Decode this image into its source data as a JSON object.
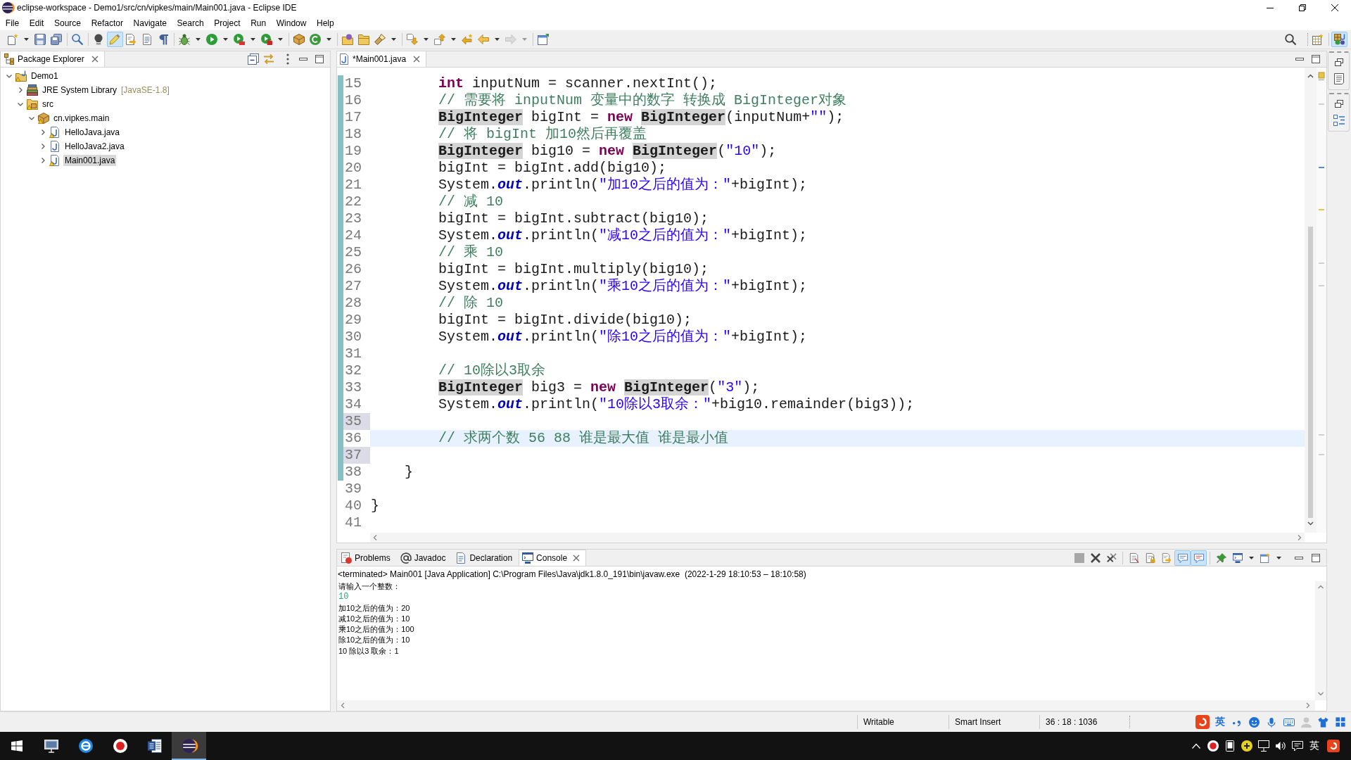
{
  "window": {
    "title": "eclipse-workspace - Demo1/src/cn/vipkes/main/Main001.java - Eclipse IDE"
  },
  "menu": [
    "File",
    "Edit",
    "Source",
    "Refactor",
    "Navigate",
    "Search",
    "Project",
    "Run",
    "Window",
    "Help"
  ],
  "toolbar": {
    "groups": [
      {
        "items": [
          {
            "kind": "new",
            "dropdown": true,
            "on": false,
            "disabled": false
          },
          {
            "kind": "save",
            "dropdown": false,
            "on": false,
            "disabled": false
          },
          {
            "kind": "save_all",
            "dropdown": false,
            "on": false,
            "disabled": false
          }
        ]
      },
      {
        "items": [
          {
            "kind": "open_type",
            "dropdown": false,
            "on": false,
            "disabled": false
          }
        ]
      },
      {
        "items": [
          {
            "kind": "hint",
            "dropdown": false,
            "on": false,
            "disabled": false
          },
          {
            "kind": "mark_occurrences",
            "dropdown": false,
            "on": true,
            "disabled": false
          },
          {
            "kind": "block_selection",
            "dropdown": false,
            "on": false,
            "disabled": false
          },
          {
            "kind": "show_whitespace",
            "dropdown": false,
            "on": false,
            "disabled": false
          },
          {
            "kind": "show_paragraph",
            "dropdown": false,
            "on": false,
            "disabled": false
          }
        ]
      },
      {
        "items": [
          {
            "kind": "debug",
            "dropdown": true,
            "on": false,
            "disabled": false
          },
          {
            "kind": "run",
            "dropdown": true,
            "on": false,
            "disabled": false
          },
          {
            "kind": "coverage",
            "dropdown": true,
            "on": false,
            "disabled": false
          },
          {
            "kind": "external_tools",
            "dropdown": true,
            "on": false,
            "disabled": false
          }
        ]
      },
      {
        "items": [
          {
            "kind": "new_package",
            "dropdown": false,
            "on": false,
            "disabled": false
          },
          {
            "kind": "new_class",
            "dropdown": true,
            "on": false,
            "disabled": false
          }
        ]
      },
      {
        "items": [
          {
            "kind": "open_type_hierarchy",
            "dropdown": false,
            "on": false,
            "disabled": false
          },
          {
            "kind": "open_task",
            "dropdown": false,
            "on": false,
            "disabled": false
          },
          {
            "kind": "search",
            "dropdown": true,
            "on": false,
            "disabled": false
          }
        ]
      },
      {
        "items": [
          {
            "kind": "next_annotation",
            "dropdown": true,
            "on": false,
            "disabled": false
          },
          {
            "kind": "previous_annotation",
            "dropdown": true,
            "on": false,
            "disabled": false
          },
          {
            "kind": "last_edit",
            "dropdown": false,
            "on": false,
            "disabled": false
          },
          {
            "kind": "back",
            "dropdown": true,
            "on": false,
            "disabled": false
          },
          {
            "kind": "forward",
            "dropdown": true,
            "on": false,
            "disabled": true
          }
        ]
      },
      {
        "items": [
          {
            "kind": "pin_editor",
            "dropdown": false,
            "on": false,
            "disabled": false
          }
        ]
      }
    ],
    "right": [
      {
        "kind": "search_all",
        "on": false
      },
      {
        "kind": "open_perspective",
        "on": false
      },
      {
        "kind": "java_perspective",
        "on": true
      }
    ]
  },
  "package_explorer": {
    "tabs": [
      {
        "label": "Package Explorer",
        "selected": true
      }
    ],
    "tree": [
      {
        "label": "Demo1",
        "kind": "project",
        "expanded": true,
        "selected": false,
        "warning": true,
        "children": [
          {
            "label": "JRE System Library",
            "decoration": "[JavaSE-1.8]",
            "kind": "library",
            "expanded": false,
            "selected": false,
            "warning": false
          },
          {
            "label": "src",
            "kind": "source_folder",
            "expanded": true,
            "selected": false,
            "warning": true,
            "children": [
              {
                "label": "cn.vipkes.main",
                "kind": "package",
                "expanded": true,
                "selected": false,
                "warning": true,
                "children": [
                  {
                    "label": "HelloJava.java",
                    "kind": "java_file",
                    "expanded": false,
                    "selected": false,
                    "warning": true
                  },
                  {
                    "label": "HelloJava2.java",
                    "kind": "java_file",
                    "expanded": false,
                    "selected": false,
                    "warning": false
                  },
                  {
                    "label": "Main001.java",
                    "kind": "java_file",
                    "expanded": false,
                    "selected": true,
                    "warning": true
                  }
                ]
              }
            ]
          }
        ]
      }
    ]
  },
  "editor": {
    "tabs": [
      {
        "title": "*Main001.java",
        "selected": true
      }
    ],
    "lines": [
      {
        "number": "15",
        "added": true,
        "changed": false,
        "current": false,
        "tokens": [
          {
            "kind": "keyword",
            "text": "        int"
          },
          {
            "kind": "plain",
            "text": " inputNum = scanner.nextInt();"
          }
        ]
      },
      {
        "number": "16",
        "added": true,
        "changed": false,
        "current": false,
        "tokens": [
          {
            "kind": "comment",
            "text": "        // 需要将 inputNum 变量中的数字 转换成 BigInteger对象"
          }
        ]
      },
      {
        "number": "17",
        "added": true,
        "changed": false,
        "current": false,
        "tokens": [
          {
            "kind": "occurrence",
            "text": "        BigInteger"
          },
          {
            "kind": "plain",
            "text": " bigInt = "
          },
          {
            "kind": "keyword",
            "text": "new "
          },
          {
            "kind": "occurrence",
            "text": "BigInteger"
          },
          {
            "kind": "plain",
            "text": "(inputNum+"
          },
          {
            "kind": "string",
            "text": "\"\""
          },
          {
            "kind": "plain",
            "text": ");"
          }
        ]
      },
      {
        "number": "18",
        "added": true,
        "changed": false,
        "current": false,
        "tokens": [
          {
            "kind": "comment",
            "text": "        // 将 bigInt 加10然后再覆盖"
          }
        ]
      },
      {
        "number": "19",
        "added": true,
        "changed": false,
        "current": false,
        "tokens": [
          {
            "kind": "occurrence",
            "text": "        BigInteger"
          },
          {
            "kind": "plain",
            "text": " big10 = "
          },
          {
            "kind": "keyword",
            "text": "new "
          },
          {
            "kind": "occurrence",
            "text": "BigInteger"
          },
          {
            "kind": "plain",
            "text": "("
          },
          {
            "kind": "string",
            "text": "\"10\""
          },
          {
            "kind": "plain",
            "text": ");"
          }
        ]
      },
      {
        "number": "20",
        "added": true,
        "changed": false,
        "current": false,
        "tokens": [
          {
            "kind": "plain",
            "text": "        bigInt = bigInt.add(big10);"
          }
        ]
      },
      {
        "number": "21",
        "added": true,
        "changed": false,
        "current": false,
        "tokens": [
          {
            "kind": "plain",
            "text": "        System."
          },
          {
            "kind": "field",
            "text": "out"
          },
          {
            "kind": "plain",
            "text": ".println("
          },
          {
            "kind": "string",
            "text": "\"加10之后的值为：\""
          },
          {
            "kind": "plain",
            "text": "+bigInt);"
          }
        ]
      },
      {
        "number": "22",
        "added": true,
        "changed": false,
        "current": false,
        "tokens": [
          {
            "kind": "comment",
            "text": "        // 减 10"
          }
        ]
      },
      {
        "number": "23",
        "added": true,
        "changed": false,
        "current": false,
        "tokens": [
          {
            "kind": "plain",
            "text": "        bigInt = bigInt.subtract(big10);"
          }
        ]
      },
      {
        "number": "24",
        "added": true,
        "changed": false,
        "current": false,
        "tokens": [
          {
            "kind": "plain",
            "text": "        System."
          },
          {
            "kind": "field",
            "text": "out"
          },
          {
            "kind": "plain",
            "text": ".println("
          },
          {
            "kind": "string",
            "text": "\"减10之后的值为：\""
          },
          {
            "kind": "plain",
            "text": "+bigInt);"
          }
        ]
      },
      {
        "number": "25",
        "added": true,
        "changed": false,
        "current": false,
        "tokens": [
          {
            "kind": "comment",
            "text": "        // 乘 10"
          }
        ]
      },
      {
        "number": "26",
        "added": true,
        "changed": false,
        "current": false,
        "tokens": [
          {
            "kind": "plain",
            "text": "        bigInt = bigInt.multiply(big10);"
          }
        ]
      },
      {
        "number": "27",
        "added": true,
        "changed": false,
        "current": false,
        "tokens": [
          {
            "kind": "plain",
            "text": "        System."
          },
          {
            "kind": "field",
            "text": "out"
          },
          {
            "kind": "plain",
            "text": ".println("
          },
          {
            "kind": "string",
            "text": "\"乘10之后的值为：\""
          },
          {
            "kind": "plain",
            "text": "+bigInt);"
          }
        ]
      },
      {
        "number": "28",
        "added": true,
        "changed": false,
        "current": false,
        "tokens": [
          {
            "kind": "comment",
            "text": "        // 除 10"
          }
        ]
      },
      {
        "number": "29",
        "added": true,
        "changed": false,
        "current": false,
        "tokens": [
          {
            "kind": "plain",
            "text": "        bigInt = bigInt.divide(big10);"
          }
        ]
      },
      {
        "number": "30",
        "added": true,
        "changed": false,
        "current": false,
        "tokens": [
          {
            "kind": "plain",
            "text": "        System."
          },
          {
            "kind": "field",
            "text": "out"
          },
          {
            "kind": "plain",
            "text": ".println("
          },
          {
            "kind": "string",
            "text": "\"除10之后的值为：\""
          },
          {
            "kind": "plain",
            "text": "+bigInt);"
          }
        ]
      },
      {
        "number": "31",
        "added": true,
        "changed": false,
        "current": false
      },
      {
        "number": "32",
        "added": true,
        "changed": false,
        "current": false,
        "tokens": [
          {
            "kind": "comment",
            "text": "        // 10除以3取余"
          }
        ]
      },
      {
        "number": "33",
        "added": true,
        "changed": false,
        "current": false,
        "tokens": [
          {
            "kind": "occurrence",
            "text": "        BigInteger"
          },
          {
            "kind": "plain",
            "text": " big3 = "
          },
          {
            "kind": "keyword",
            "text": "new "
          },
          {
            "kind": "occurrence",
            "text": "BigInteger"
          },
          {
            "kind": "plain",
            "text": "("
          },
          {
            "kind": "string",
            "text": "\"3\""
          },
          {
            "kind": "plain",
            "text": ");"
          }
        ]
      },
      {
        "number": "34",
        "added": true,
        "changed": false,
        "current": false,
        "tokens": [
          {
            "kind": "plain",
            "text": "        System."
          },
          {
            "kind": "field",
            "text": "out"
          },
          {
            "kind": "plain",
            "text": ".println("
          },
          {
            "kind": "string",
            "text": "\"10除以3取余：\""
          },
          {
            "kind": "plain",
            "text": "+big10.remainder(big3));"
          }
        ]
      },
      {
        "number": "35",
        "added": true,
        "changed": true,
        "current": false
      },
      {
        "number": "36",
        "added": true,
        "changed": false,
        "current": true,
        "tokens": [
          {
            "kind": "comment",
            "text": "        // 求两个数 56 88 谁是最大值 谁是最小值"
          }
        ]
      },
      {
        "number": "37",
        "added": true,
        "changed": true,
        "current": false
      },
      {
        "number": "38",
        "added": true,
        "changed": false,
        "current": false,
        "tokens": [
          {
            "kind": "plain",
            "text": "    }"
          }
        ]
      },
      {
        "number": "39",
        "added": false,
        "changed": false,
        "current": false
      },
      {
        "number": "40",
        "added": false,
        "changed": false,
        "current": false,
        "tokens": [
          {
            "kind": "plain",
            "text": "}"
          }
        ]
      },
      {
        "number": "41",
        "added": false,
        "changed": false,
        "current": false
      }
    ]
  },
  "bottom_panel": {
    "tabs": [
      {
        "label": "Problems",
        "kind": "problems",
        "selected": false
      },
      {
        "label": "Javadoc",
        "kind": "javadoc",
        "selected": false
      },
      {
        "label": "Declaration",
        "kind": "declaration",
        "selected": false
      },
      {
        "label": "Console",
        "kind": "console",
        "selected": true
      }
    ],
    "toolbar": [
      {
        "items": [
          {
            "kind": "terminate",
            "dropdown": false,
            "on": false,
            "disabled": true
          },
          {
            "kind": "remove_launch",
            "dropdown": false,
            "on": false,
            "disabled": false
          },
          {
            "kind": "remove_all_terminated",
            "dropdown": false,
            "on": false,
            "disabled": false
          }
        ]
      },
      {
        "items": [
          {
            "kind": "clear",
            "dropdown": false,
            "on": false,
            "disabled": false
          },
          {
            "kind": "scroll_lock",
            "dropdown": false,
            "on": false,
            "disabled": false
          },
          {
            "kind": "word_wrap",
            "dropdown": false,
            "on": false,
            "disabled": false
          },
          {
            "kind": "show_stdout",
            "dropdown": false,
            "on": true,
            "disabled": false
          },
          {
            "kind": "show_stderr",
            "dropdown": false,
            "on": true,
            "disabled": false
          }
        ]
      },
      {
        "items": [
          {
            "kind": "pin",
            "dropdown": false,
            "on": false,
            "disabled": false
          },
          {
            "kind": "display_console",
            "dropdown": true,
            "on": false,
            "disabled": false
          },
          {
            "kind": "open_console",
            "dropdown": true,
            "on": false,
            "disabled": false
          }
        ]
      }
    ],
    "console": {
      "description": "<terminated> Main001 [Java Application] C:\\Program Files\\Java\\jdk1.8.0_191\\bin\\javaw.exe  (2022-1-29 18:10:53 – 18:10:58)",
      "lines": [
        {
          "text": "请输入一个整数：",
          "kind": "output"
        },
        {
          "text": "10",
          "kind": "input"
        },
        {
          "text": "加10之后的值为：20",
          "kind": "output"
        },
        {
          "text": "减10之后的值为：10",
          "kind": "output"
        },
        {
          "text": "乘10之后的值为：100",
          "kind": "output"
        },
        {
          "text": "除10之后的值为：10",
          "kind": "output"
        },
        {
          "text": "10 除以3 取余：1",
          "kind": "output"
        }
      ]
    }
  },
  "status_bar": {
    "fields": [
      "Writable",
      "Smart Insert",
      "36 : 18 : 1036"
    ],
    "ime_mode": "英"
  },
  "taskbar": {
    "apps": [
      {
        "kind": "computer",
        "active": false
      },
      {
        "kind": "browser",
        "active": false
      },
      {
        "kind": "recorder",
        "active": false
      },
      {
        "kind": "word",
        "active": false
      },
      {
        "kind": "ide",
        "active": true
      }
    ],
    "language": "英"
  }
}
